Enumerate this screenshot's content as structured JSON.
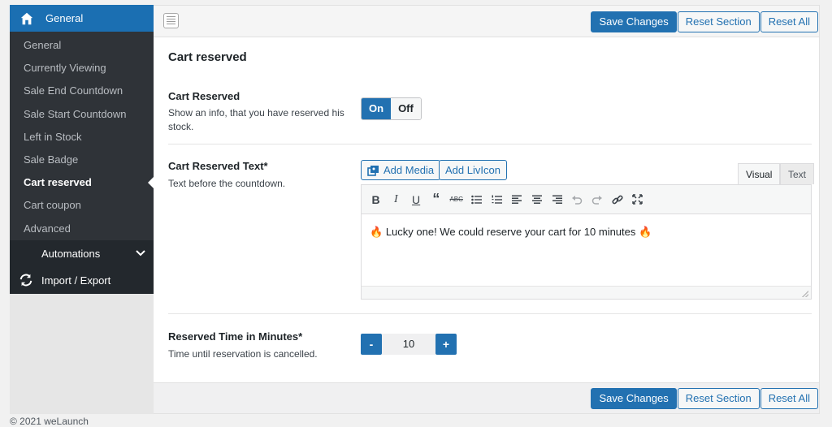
{
  "sidebar": {
    "header_label": "General",
    "items": [
      {
        "label": "General"
      },
      {
        "label": "Currently Viewing"
      },
      {
        "label": "Sale End Countdown"
      },
      {
        "label": "Sale Start Countdown"
      },
      {
        "label": "Left in Stock"
      },
      {
        "label": "Sale Badge"
      },
      {
        "label": "Cart reserved"
      },
      {
        "label": "Cart coupon"
      },
      {
        "label": "Advanced"
      }
    ],
    "active_item": "Cart reserved",
    "automations_label": "Automations",
    "import_export_label": "Import / Export"
  },
  "toolbar": {
    "save_label": "Save Changes",
    "reset_section_label": "Reset Section",
    "reset_all_label": "Reset All"
  },
  "section": {
    "title": "Cart reserved"
  },
  "cart_reserved": {
    "title": "Cart Reserved",
    "description": "Show an info, that you have reserved his stock.",
    "on_label": "On",
    "off_label": "Off",
    "value": "On"
  },
  "cart_reserved_text": {
    "title": "Cart Reserved Text*",
    "description": "Text before the countdown.",
    "add_media_label": "Add Media",
    "add_livicon_label": "Add LivIcon",
    "tab_visual": "Visual",
    "tab_text": "Text",
    "content": "Lucky one! We could reserve your cart for 10 minutes",
    "content_emoji": "🔥"
  },
  "reserved_time": {
    "title": "Reserved Time in Minutes*",
    "description": "Time until reservation is cancelled.",
    "minus": "-",
    "plus": "+",
    "value": "10"
  },
  "footer": {
    "text": "© 2021 weLaunch"
  },
  "colors": {
    "accent": "#2271b1",
    "sidebar_dark": "#2f3338",
    "sidebar_header": "#1b6fb2"
  }
}
